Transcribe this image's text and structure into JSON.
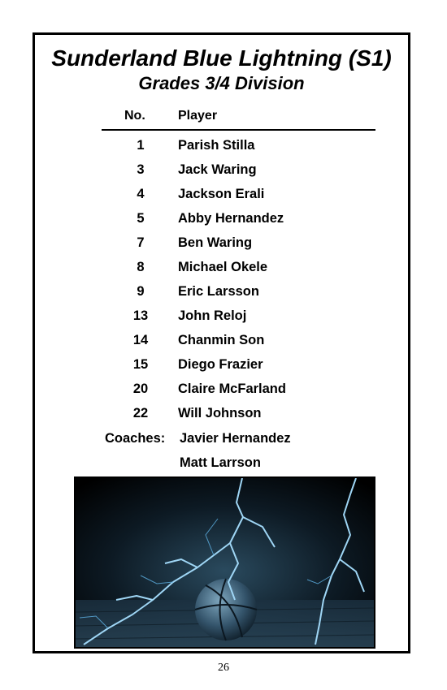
{
  "header": {
    "title": "Sunderland Blue Lightning (S1)",
    "subtitle": "Grades 3/4 Division"
  },
  "columns": {
    "number": "No.",
    "player": "Player"
  },
  "roster": [
    {
      "number": "1",
      "name": "Parish Stilla"
    },
    {
      "number": "3",
      "name": "Jack Waring"
    },
    {
      "number": "4",
      "name": "Jackson Erali"
    },
    {
      "number": "5",
      "name": "Abby Hernandez"
    },
    {
      "number": "7",
      "name": "Ben Waring"
    },
    {
      "number": "8",
      "name": "Michael Okele"
    },
    {
      "number": "9",
      "name": "Eric Larsson"
    },
    {
      "number": "13",
      "name": "John Reloj"
    },
    {
      "number": "14",
      "name": "Chanmin Son"
    },
    {
      "number": "15",
      "name": "Diego Frazier"
    },
    {
      "number": "20",
      "name": "Claire McFarland"
    },
    {
      "number": "22",
      "name": "Will Johnson"
    }
  ],
  "coaches": {
    "label": "Coaches:",
    "names": [
      "Javier Hernandez",
      "Matt Larrson"
    ]
  },
  "image": {
    "subject": "basketball-with-lightning"
  },
  "footer": {
    "page_number": "26"
  }
}
